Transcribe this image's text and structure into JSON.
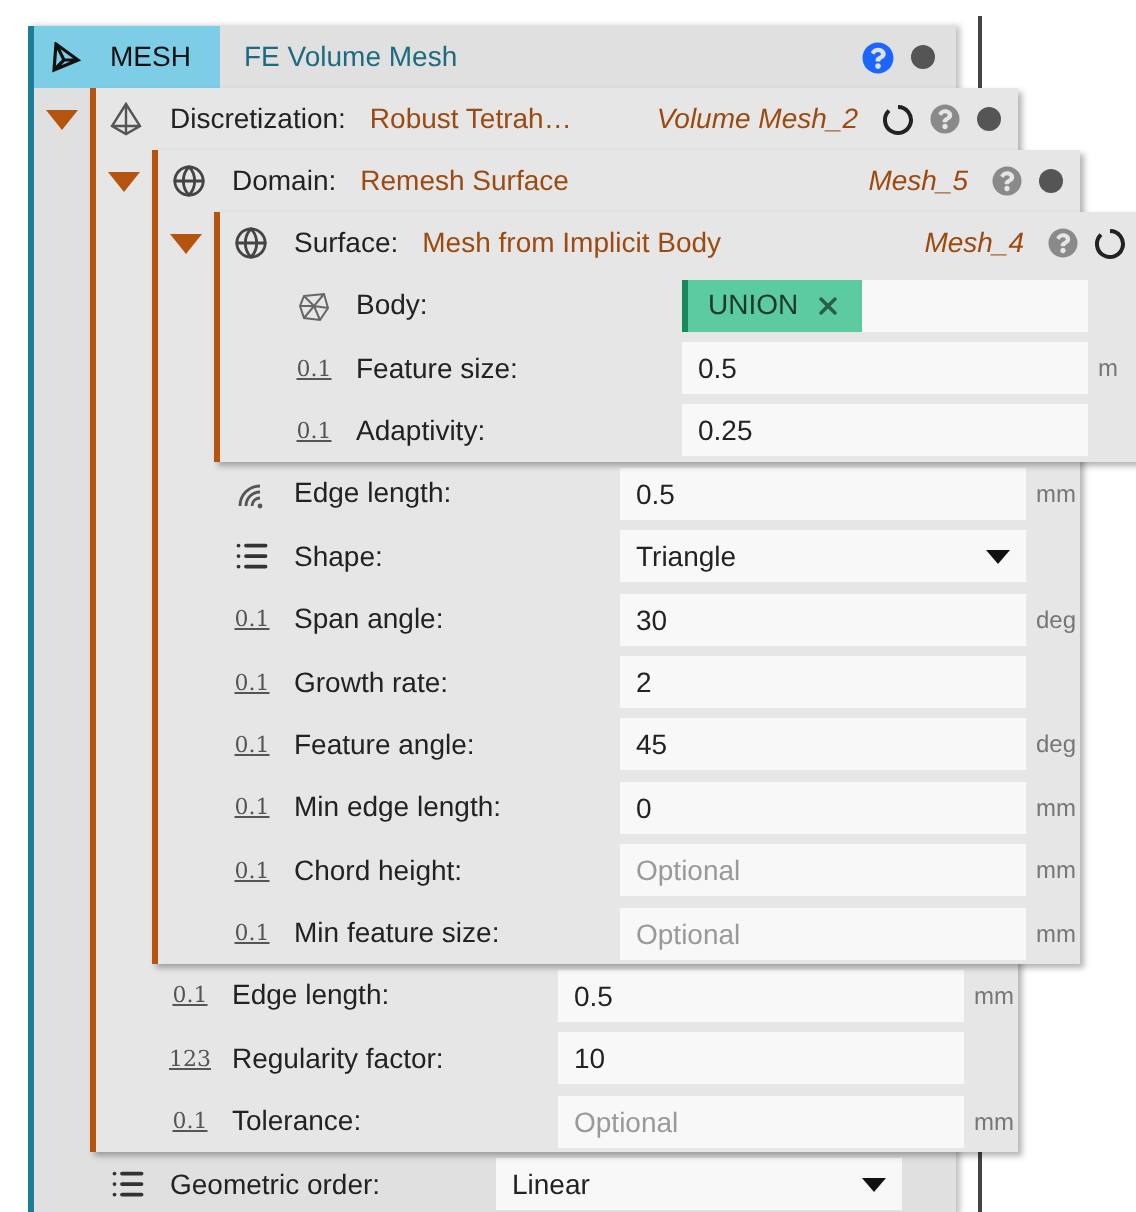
{
  "root": {
    "tag": "MESH",
    "title": "FE Volume Mesh",
    "status_icons": [
      {
        "kind": "help_active"
      },
      {
        "kind": "dot"
      }
    ],
    "children": [
      {
        "kind": "panel",
        "label": "Discretization:",
        "value": "Robust Tetrah…",
        "name": "Volume Mesh_2",
        "expanded": true,
        "status_icons": [
          {
            "kind": "ring"
          },
          {
            "kind": "help"
          },
          {
            "kind": "dot"
          }
        ],
        "children": [
          {
            "kind": "panel",
            "label": "Domain:",
            "value": "Remesh Surface",
            "name": "Mesh_5",
            "expanded": true,
            "status_icons": [
              {
                "kind": "help"
              },
              {
                "kind": "dot"
              }
            ],
            "children": [
              {
                "kind": "panel",
                "label": "Surface:",
                "value": "Mesh from Implicit Body",
                "name": "Mesh_4",
                "expanded": true,
                "status_icons": [
                  {
                    "kind": "help"
                  },
                  {
                    "kind": "ring"
                  }
                ],
                "children": [
                  {
                    "kind": "chip",
                    "label": "Body:",
                    "value": "UNION"
                  },
                  {
                    "kind": "number",
                    "icon_text": "0.1",
                    "label": "Feature size:",
                    "value": "0.5",
                    "unit": "m"
                  },
                  {
                    "kind": "number",
                    "icon_text": "0.1",
                    "label": "Adaptivity:",
                    "value": "0.25"
                  }
                ]
              },
              {
                "kind": "length",
                "label": "Edge length:",
                "value": "0.5",
                "unit": "mm"
              },
              {
                "kind": "dropdown",
                "label": "Shape:",
                "value": "Triangle"
              },
              {
                "kind": "number",
                "icon_text": "0.1",
                "label": "Span angle:",
                "value": "30",
                "unit": "deg"
              },
              {
                "kind": "number",
                "icon_text": "0.1",
                "label": "Growth rate:",
                "value": "2"
              },
              {
                "kind": "number",
                "icon_text": "0.1",
                "label": "Feature angle:",
                "value": "45",
                "unit": "deg"
              },
              {
                "kind": "number",
                "icon_text": "0.1",
                "label": "Min edge length:",
                "value": "0",
                "unit": "mm"
              },
              {
                "kind": "number",
                "icon_text": "0.1",
                "label": "Chord height:",
                "placeholder": "Optional",
                "unit": "mm"
              },
              {
                "kind": "number",
                "icon_text": "0.1",
                "label": "Min feature size:",
                "placeholder": "Optional",
                "unit": "mm"
              }
            ]
          },
          {
            "kind": "number",
            "icon_text": "0.1",
            "label": "Edge length:",
            "value": "0.5",
            "unit": "mm"
          },
          {
            "kind": "number",
            "icon_text": "123",
            "label": "Regularity factor:",
            "value": "10"
          },
          {
            "kind": "number",
            "icon_text": "0.1",
            "label": "Tolerance:",
            "placeholder": "Optional",
            "unit": "mm"
          }
        ]
      },
      {
        "kind": "dropdown",
        "label": "Geometric order:",
        "value": "Linear"
      }
    ]
  }
}
